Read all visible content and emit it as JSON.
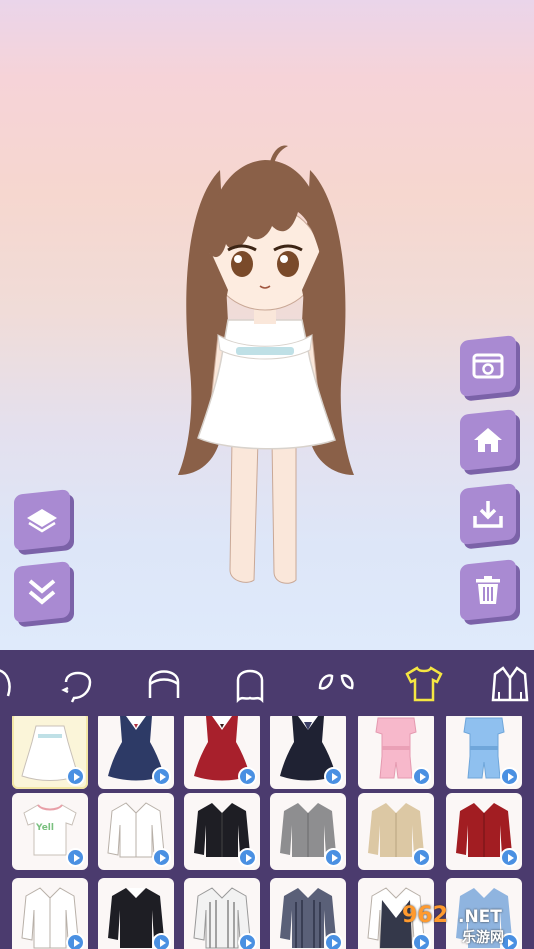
{
  "stage": {
    "side_buttons_right": [
      {
        "name": "camera-button",
        "icon": "camera-icon"
      },
      {
        "name": "home-button",
        "icon": "home-icon"
      },
      {
        "name": "download-button",
        "icon": "download-icon"
      },
      {
        "name": "delete-button",
        "icon": "trash-icon"
      }
    ],
    "side_buttons_left": [
      {
        "name": "layers-button",
        "icon": "layers-icon"
      },
      {
        "name": "collapse-button",
        "icon": "double-chevron-down-icon"
      }
    ]
  },
  "toolbar": {
    "tabs": [
      {
        "name": "tab-body",
        "icon": "body-icon"
      },
      {
        "name": "tab-face",
        "icon": "face-icon"
      },
      {
        "name": "tab-hair-front",
        "icon": "hair-front-icon"
      },
      {
        "name": "tab-hair-back",
        "icon": "hair-back-icon"
      },
      {
        "name": "tab-accessory",
        "icon": "leaf-accessory-icon"
      },
      {
        "name": "tab-tops",
        "icon": "tshirt-icon",
        "selected": true
      },
      {
        "name": "tab-outerwear",
        "icon": "cardigan-icon"
      }
    ],
    "selected_color": "#f5e642"
  },
  "items": {
    "rows": [
      [
        "white-ruffle-dress",
        "navy-sailor-dress",
        "red-sailor-dress",
        "black-sailor-dress",
        "pink-romper",
        "blue-romper"
      ],
      [
        "yell-tshirt",
        "white-shirt",
        "black-shirt",
        "gray-shirt",
        "beige-shirt",
        "red-shirt"
      ],
      [
        "white-blouse",
        "black-blouse",
        "striped-shirt",
        "navy-striped-shirt",
        "vest-shirt",
        "blue-shirt"
      ]
    ],
    "tee_text": "Yell"
  },
  "watermark": {
    "line1": "962",
    "line2": ".NET",
    "line3": "乐游网"
  }
}
